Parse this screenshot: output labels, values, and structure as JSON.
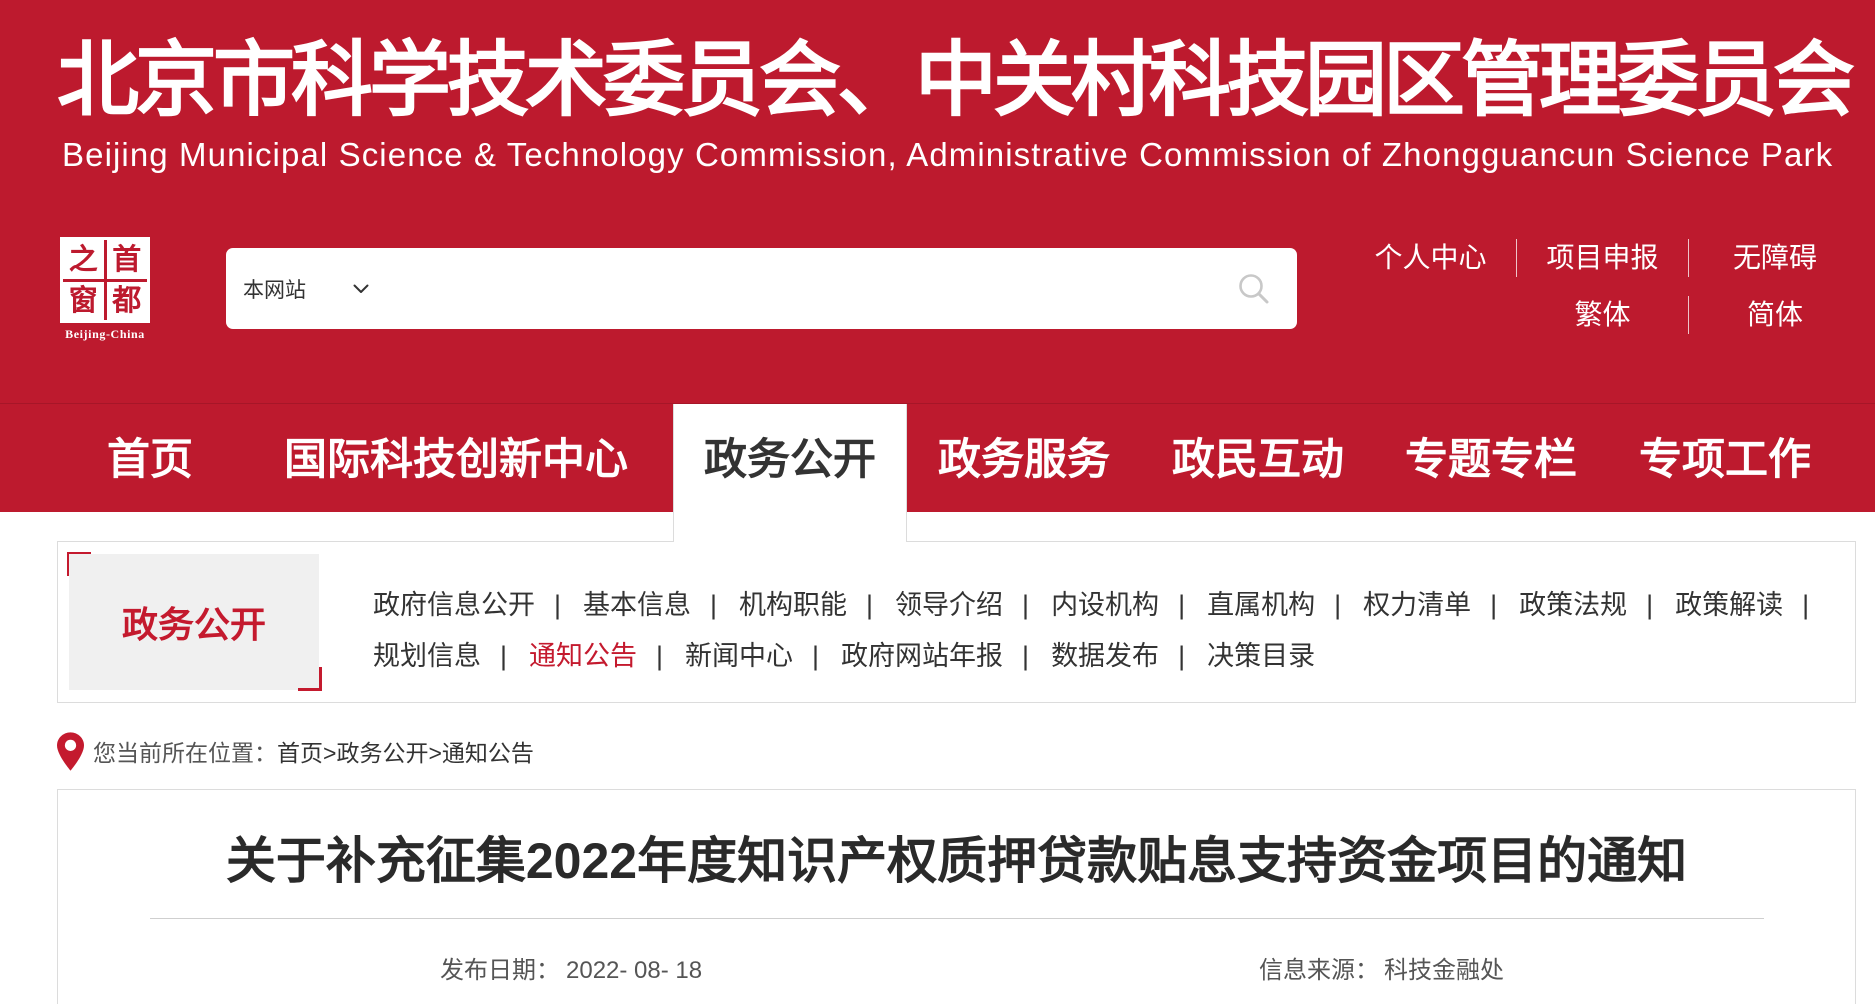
{
  "header": {
    "title_cn": "北京市科学技术委员会、中关村科技园区管理委员会",
    "title_en": "Beijing Municipal Science & Technology Commission, Administrative Commission of Zhongguancun Science Park"
  },
  "logo": {
    "chars": [
      "首",
      "都",
      "之",
      "窗"
    ],
    "caption": "Beijing-China"
  },
  "search": {
    "scope": "本网站",
    "icons": {
      "scope": "chevron-down-icon",
      "submit": "search-icon"
    }
  },
  "top_links": [
    "个人中心",
    "项目申报",
    "无障碍",
    "繁体",
    "简体"
  ],
  "main_nav": [
    {
      "label": "首页"
    },
    {
      "label": "国际科技创新中心"
    },
    {
      "label": "政务公开",
      "active": true
    },
    {
      "label": "政务服务"
    },
    {
      "label": "政民互动"
    },
    {
      "label": "专题专栏"
    },
    {
      "label": "专项工作"
    }
  ],
  "sub_nav": {
    "section_title": "政务公开",
    "separator": "|",
    "links": [
      {
        "label": "政府信息公开"
      },
      {
        "label": "基本信息"
      },
      {
        "label": "机构职能"
      },
      {
        "label": "领导介绍"
      },
      {
        "label": "内设机构"
      },
      {
        "label": "直属机构"
      },
      {
        "label": "权力清单"
      },
      {
        "label": "政策法规"
      },
      {
        "label": "政策解读"
      },
      {
        "label": "规划信息"
      },
      {
        "label": "通知公告",
        "active": true
      },
      {
        "label": "新闻中心"
      },
      {
        "label": "政府网站年报"
      },
      {
        "label": "数据发布"
      },
      {
        "label": "决策目录"
      }
    ]
  },
  "breadcrumb": {
    "icon": "location-pin-icon",
    "label": "您当前所在位置：",
    "separator": ">",
    "items": [
      "首页",
      "政务公开",
      "通知公告"
    ]
  },
  "article": {
    "title": "关于补充征集2022年度知识产权质押贷款贴息支持资金项目的通知",
    "publish_label": "发布日期：",
    "publish_date": "2022- 08- 18",
    "source_label": "信息来源：",
    "source": "科技金融处"
  },
  "colors": {
    "brand_red": "#bd1a2e",
    "active_red": "#c41a2e",
    "text": "#333333",
    "border": "#dcdcdc"
  }
}
